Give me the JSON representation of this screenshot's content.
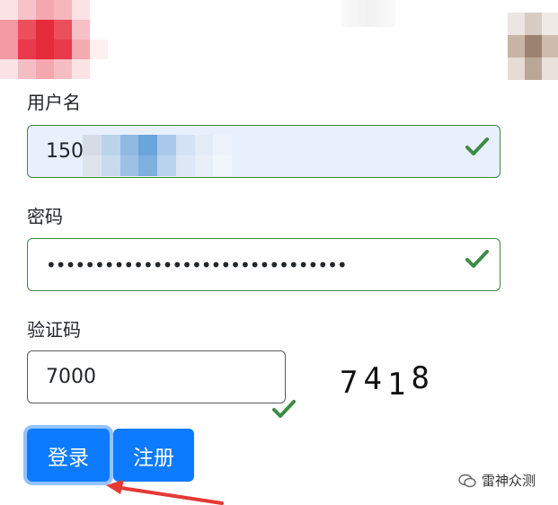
{
  "form": {
    "username": {
      "label": "用户名",
      "value_prefix": "150"
    },
    "password": {
      "label": "密码",
      "masked_value": "•••••••••••••••••••••••••••••••"
    },
    "captcha": {
      "label": "验证码",
      "value": "7000",
      "image_chars": [
        "7",
        "4",
        "1",
        "8"
      ]
    }
  },
  "buttons": {
    "login": "登录",
    "register": "注册"
  },
  "watermark": {
    "text": "雷神众测"
  },
  "colors": {
    "primary": "#0d7bff",
    "valid": "#3d8b47",
    "arrow": "#e53935"
  }
}
